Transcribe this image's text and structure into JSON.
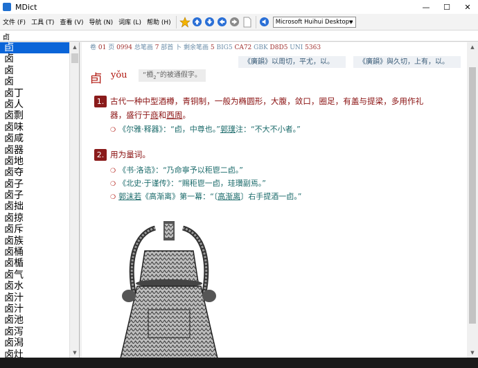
{
  "window": {
    "title": "MDict",
    "controls": [
      "—",
      "☐",
      "✕"
    ]
  },
  "menu": [
    "文件 (F)",
    "工具 (T)",
    "查看 (V)",
    "导航 (N)",
    "词库 (L)",
    "帮助 (H)"
  ],
  "toolbar": {
    "dictionary_selected": "Microsoft Huihui Desktop - C"
  },
  "search": {
    "value": "卣"
  },
  "word_list": [
    "卣",
    "卤",
    "卤",
    "卤",
    "卤丁",
    "卤人",
    "卤剽",
    "卤味",
    "卤咸",
    "卤器",
    "卤地",
    "卤夺",
    "卤子",
    "卤子",
    "卤拙",
    "卤掠",
    "卤斥",
    "卤族",
    "卤桶",
    "卤楯",
    "卤气",
    "卤水",
    "卤汁",
    "卤汁",
    "卤池",
    "卤泻",
    "卤潟",
    "卤灶"
  ],
  "entry": {
    "header": {
      "pre1": "卷 ",
      "vol": "01",
      "pre2": " 页 ",
      "page": "0994",
      "pre3": " 总笔画 ",
      "strokes": "7",
      "pre4": " 部首 卜 剩余笔画 ",
      "rem": "5",
      "pre5": " BIG5 ",
      "big5": "CA72",
      "pre6": " GBK ",
      "gbk": "D8D5",
      "pre7": " UNI ",
      "uni": "5363"
    },
    "guangyun_1": "《廣韻》以周切，平尤，以。",
    "guangyun_2": "《廣韻》與久切，上有，以。",
    "headword": "卣",
    "pinyin": "yǒu",
    "jiajie": {
      "pre": "“",
      "char": "槱",
      "sub": "2",
      "post": "”的被通假字。"
    },
    "sense1": {
      "num": "1.",
      "line1": "古代一种中型酒樽，青铜制，一般为椭圆形，大腹，敛口，圈足，有盖与提梁，多用作礼",
      "line2_pre": "器，盛行于",
      "shang": "商",
      "he": "和",
      "xizhou": "西周",
      "end": "。",
      "examples": [
        {
          "bullet": "❍",
          "src": "《尔雅·释器》：",
          "quote": "“卣，中尊也。”",
          "person": "郭璞",
          "tail": "注：“不大不小者。”"
        }
      ]
    },
    "sense2": {
      "num": "2.",
      "text": "用为量词。",
      "examples": [
        {
          "bullet": "❍",
          "text": "《书·洛诰》：“乃命寧予以秬鬯二卣。”"
        },
        {
          "bullet": "❍",
          "text": "《北史·于谨传》：“赐秬鬯一卣，珪瓚副焉。”"
        },
        {
          "bullet": "❍",
          "person": "郭沫若",
          "mid": "《高渐离》第一幕：“〔",
          "name": "高渐离",
          "tail": "〕右手提酒一卣。”"
        }
      ]
    }
  },
  "colors": {
    "accent": "#8a1b1b",
    "link": "#1a6a6a",
    "selection": "#0a64d8"
  },
  "icons": [
    "star-icon",
    "arrow-up-icon",
    "arrow-down-icon",
    "arrow-left-icon",
    "arrow-right-icon",
    "page-icon",
    "speaker-icon"
  ]
}
